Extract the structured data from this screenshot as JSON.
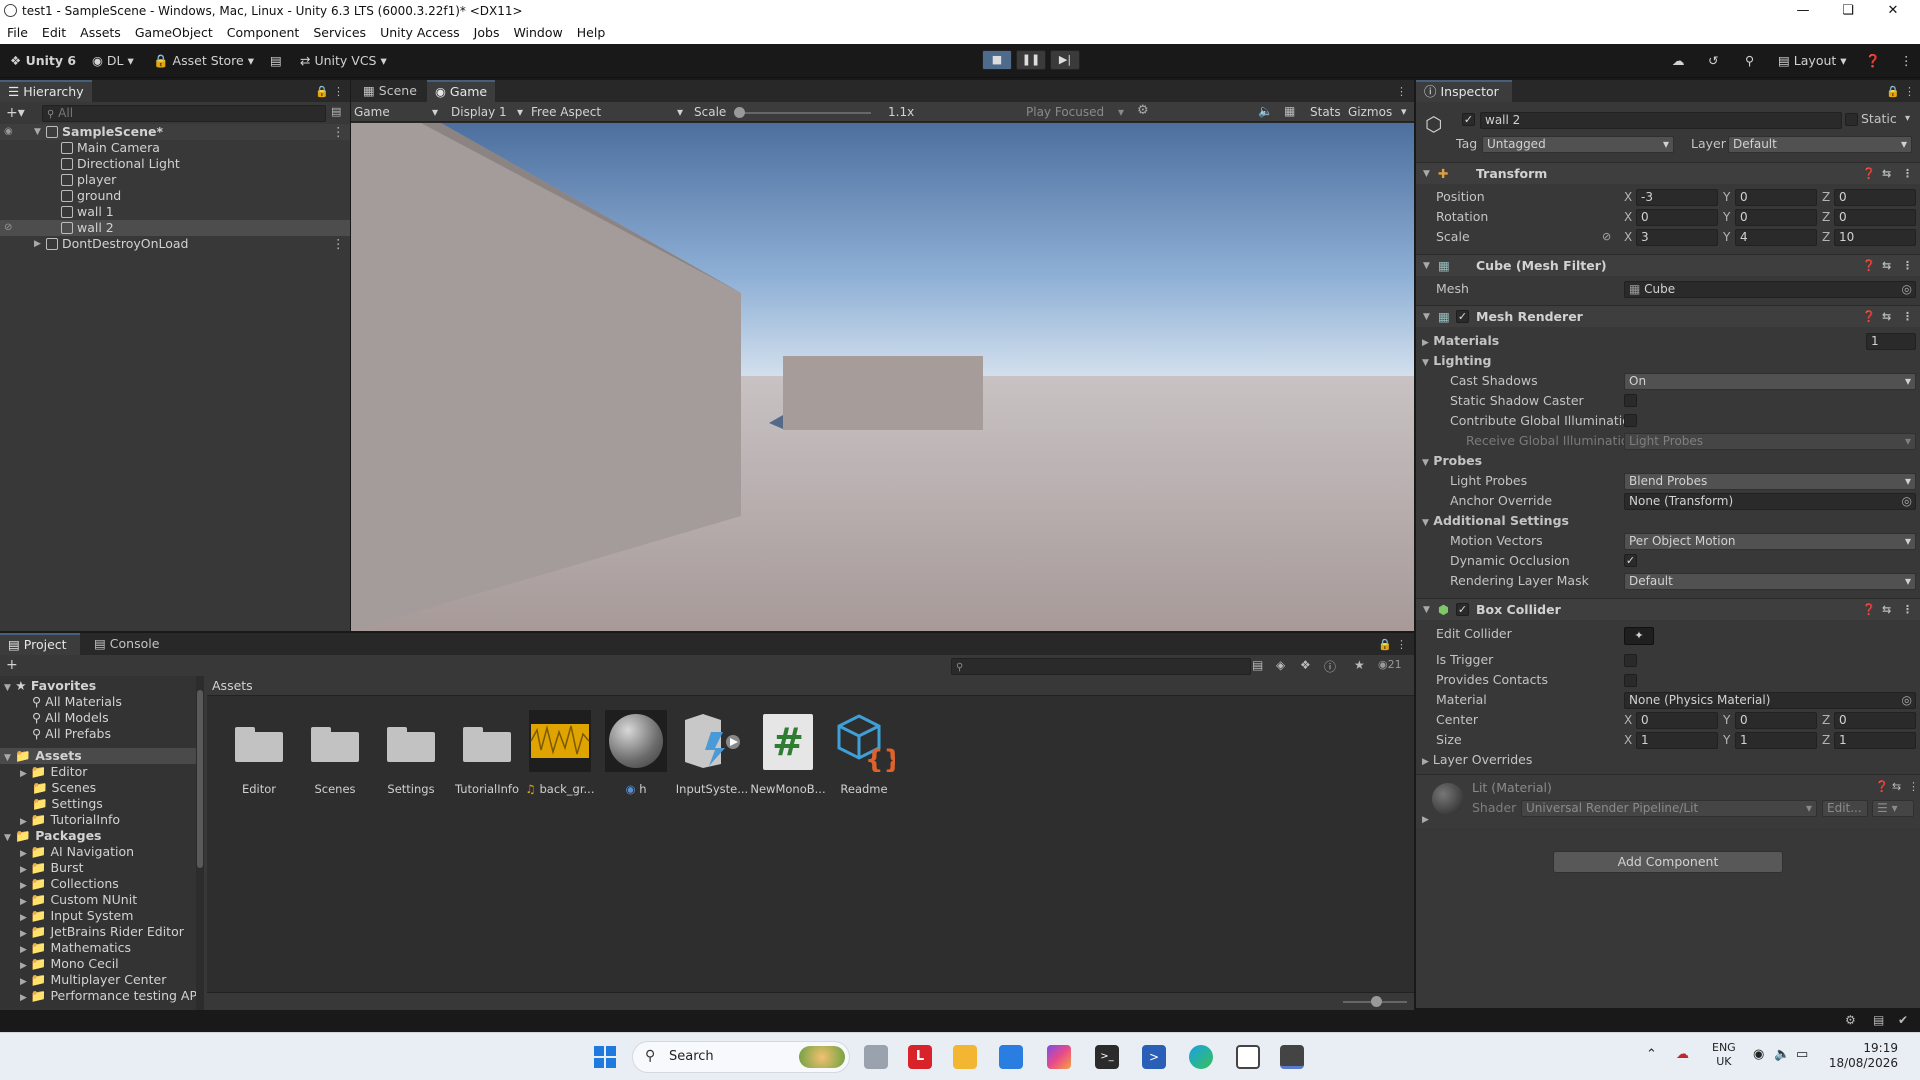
{
  "window": {
    "title": "test1 - SampleScene - Windows, Mac, Linux - Unity 6.3 LTS (6000.3.22f1)* <DX11>"
  },
  "menu": [
    "File",
    "Edit",
    "Assets",
    "GameObject",
    "Component",
    "Services",
    "Unity Access",
    "Jobs",
    "Window",
    "Help"
  ],
  "toolbar": {
    "unity": "Unity 6",
    "account": "DL",
    "asset_store": "Asset Store",
    "vcs": "Unity VCS",
    "layout": "Layout"
  },
  "hierarchy": {
    "tab": "Hierarchy",
    "search_placeholder": "All",
    "scene": "SampleScene*",
    "items": [
      "Main Camera",
      "Directional Light",
      "player",
      "ground",
      "wall 1",
      "wall 2"
    ],
    "dont_destroy": "DontDestroyOnLoad",
    "selected": "wall 2"
  },
  "view_tabs": {
    "scene": "Scene",
    "game": "Game"
  },
  "game_bar": {
    "mode": "Game",
    "display": "Display 1",
    "aspect": "Free Aspect",
    "scale_label": "Scale",
    "scale_value": "1.1x",
    "play_focused": "Play Focused",
    "stats": "Stats",
    "gizmos": "Gizmos"
  },
  "inspector": {
    "tab": "Inspector",
    "object_name": "wall 2",
    "static": "Static",
    "tag_label": "Tag",
    "tag": "Untagged",
    "layer_label": "Layer",
    "layer": "Default",
    "transform": {
      "title": "Transform",
      "position_label": "Position",
      "rotation_label": "Rotation",
      "scale_label": "Scale",
      "position": [
        "-3",
        "0",
        "0"
      ],
      "rotation": [
        "0",
        "0",
        "0"
      ],
      "scale": [
        "3",
        "4",
        "10"
      ]
    },
    "mesh_filter": {
      "title": "Cube (Mesh Filter)",
      "mesh_label": "Mesh",
      "mesh": "Cube"
    },
    "mesh_renderer": {
      "title": "Mesh Renderer",
      "materials_label": "Materials",
      "materials_count": "1",
      "lighting": "Lighting",
      "cast_shadows_label": "Cast Shadows",
      "cast_shadows": "On",
      "static_shadow_caster": "Static Shadow Caster",
      "contribute_gi": "Contribute Global Illumination",
      "receive_gi_label": "Receive Global Illumination",
      "receive_gi": "Light Probes",
      "probes": "Probes",
      "light_probes_label": "Light Probes",
      "light_probes": "Blend Probes",
      "anchor_override_label": "Anchor Override",
      "anchor_override": "None (Transform)",
      "additional_settings": "Additional Settings",
      "motion_vectors_label": "Motion Vectors",
      "motion_vectors": "Per Object Motion",
      "dynamic_occlusion": "Dynamic Occlusion",
      "rendering_layer_mask_label": "Rendering Layer Mask",
      "rendering_layer_mask": "Default"
    },
    "box_collider": {
      "title": "Box Collider",
      "edit_collider": "Edit Collider",
      "is_trigger": "Is Trigger",
      "provides_contacts": "Provides Contacts",
      "material_label": "Material",
      "material": "None (Physics Material)",
      "center_label": "Center",
      "center": [
        "0",
        "0",
        "0"
      ],
      "size_label": "Size",
      "size": [
        "1",
        "1",
        "1"
      ],
      "layer_overrides": "Layer Overrides"
    },
    "material": {
      "title": "Lit (Material)",
      "shader_label": "Shader",
      "shader": "Universal Render Pipeline/Lit",
      "edit": "Edit..."
    },
    "add_component": "Add Component"
  },
  "project": {
    "tab": "Project",
    "console_tab": "Console",
    "hidden_count": "21",
    "favorites": "Favorites",
    "favorites_items": [
      "All Materials",
      "All Models",
      "All Prefabs"
    ],
    "assets_root": "Assets",
    "assets_folders": [
      "Editor",
      "Scenes",
      "Settings",
      "TutorialInfo"
    ],
    "packages_root": "Packages",
    "packages": [
      "AI Navigation",
      "Burst",
      "Collections",
      "Custom NUnit",
      "Input System",
      "JetBrains Rider Editor",
      "Mathematics",
      "Mono Cecil",
      "Multiplayer Center",
      "Performance testing API"
    ],
    "breadcrumb": "Assets",
    "grid": [
      "Editor",
      "Scenes",
      "Settings",
      "TutorialInfo",
      "back_gr...",
      "h",
      "InputSyste...",
      "NewMonoB...",
      "Readme"
    ]
  },
  "taskbar": {
    "search": "Search",
    "lang_top": "ENG",
    "lang_bottom": "UK",
    "time": "19:19",
    "date": "18/08/2026"
  },
  "colors": {
    "sky_top": "#4c6f9e",
    "sky_horizon": "#c8d8ea",
    "ground": "#a89c9b",
    "accent": "#46607c"
  }
}
